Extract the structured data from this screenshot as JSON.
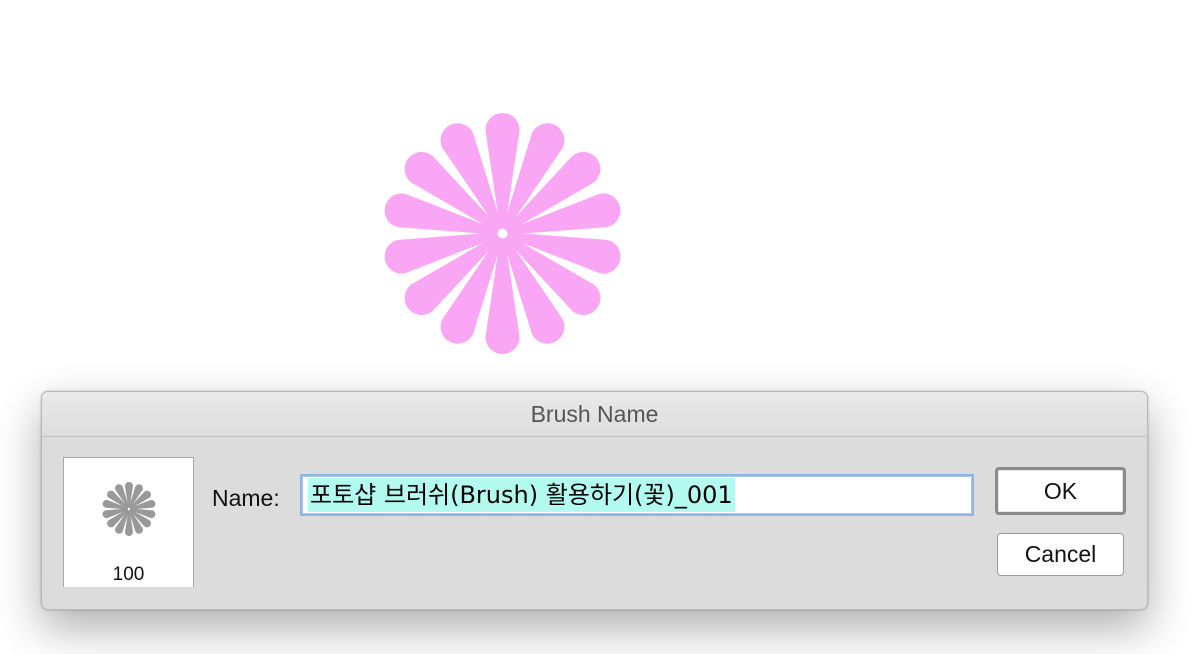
{
  "dialog": {
    "title": "Brush Name",
    "name_label": "Name:",
    "name_value": "포토샵 브러쉬(Brush) 활용하기(꽃)_001",
    "preview_size": "100",
    "ok_label": "OK",
    "cancel_label": "Cancel"
  },
  "artwork": {
    "subject": "flower-brush-shape",
    "petal_count": 14,
    "color": "#f9a6f5"
  },
  "preview": {
    "icon": "flower-brush-icon",
    "color": "#999999"
  },
  "colors": {
    "selection_highlight": "#b3fbf1",
    "dialog_bg": "#dcdcdc",
    "input_focus_border": "#8fb4e6"
  }
}
